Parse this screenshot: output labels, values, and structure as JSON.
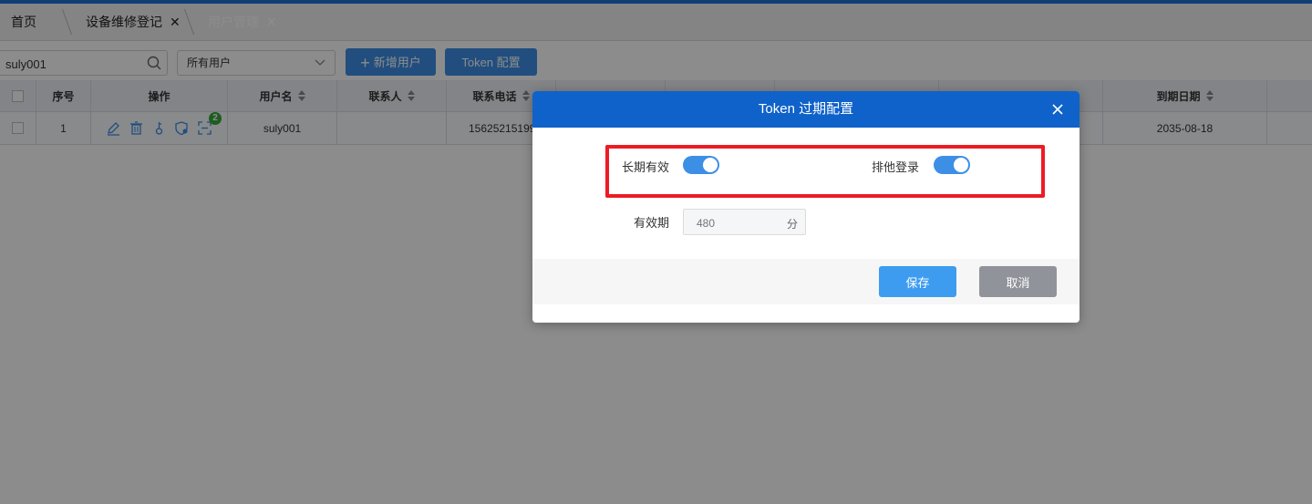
{
  "tabs": [
    {
      "label": "首页",
      "active": false
    },
    {
      "label": "设备维修登记",
      "close": "✕",
      "active": false
    },
    {
      "label": "用户管理",
      "close": "✕",
      "active": true
    }
  ],
  "toolbar": {
    "search_value": "suly001",
    "filter_selected": "所有用户",
    "add_user_label": "新增用户",
    "add_user_plus": "+",
    "token_config_label": "Token 配置"
  },
  "table": {
    "columns": [
      "序号",
      "操作",
      "用户名",
      "联系人",
      "联系电话",
      "到期日期"
    ],
    "rows": [
      {
        "index": "1",
        "username": "suly001",
        "contact": "",
        "phone": "15625215199",
        "expire": "2035-08-18",
        "badge": "2"
      }
    ]
  },
  "dialog": {
    "title": "Token 过期配置",
    "long_term_label": "长期有效",
    "long_term_on": true,
    "exclusive_login_label": "排他登录",
    "exclusive_login_on": true,
    "validity_label": "有效期",
    "validity_placeholder": "480",
    "validity_unit": "分",
    "save_label": "保存",
    "cancel_label": "取消"
  },
  "colors": {
    "primary": "#1f6fd6",
    "dialog_header": "#0f62c9",
    "toggle_on": "#3d8fe6",
    "highlight_box": "#ec1c24",
    "cancel_button": "#909399"
  }
}
